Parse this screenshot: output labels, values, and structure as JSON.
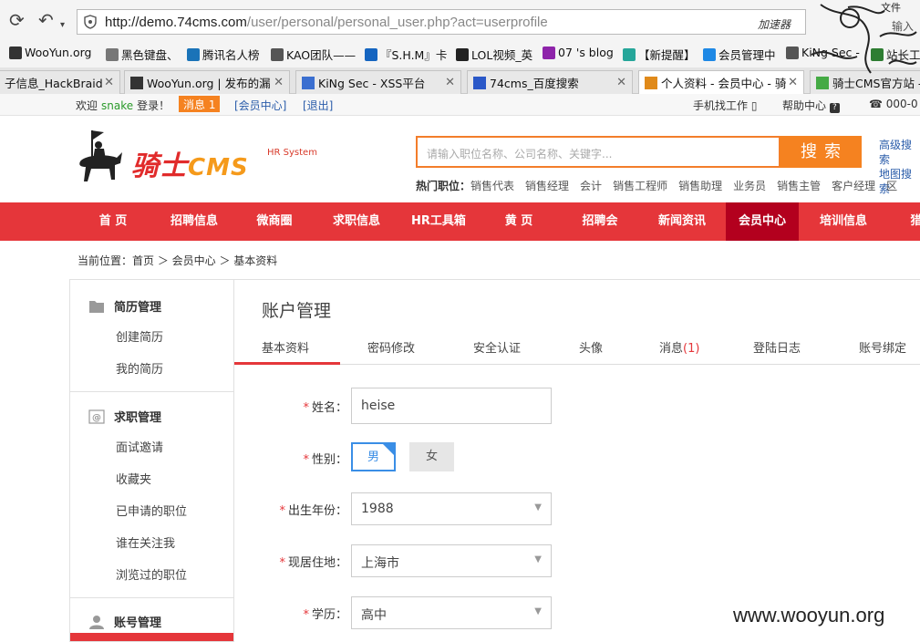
{
  "browser": {
    "url_host": "http://demo.74cms.com",
    "url_path": "/user/personal/personal_user.php?act=userprofile",
    "accelerator": "加速器",
    "menu_file": "文件",
    "menu_input": "输入",
    "bookmarks": [
      {
        "label": "WooYun.org",
        "color": "#333"
      },
      {
        "label": "黑色键盘、",
        "color": "#777"
      },
      {
        "label": "腾讯名人榜",
        "color": "#1a73b8"
      },
      {
        "label": "KAO团队——",
        "color": "#555"
      },
      {
        "label": "『S.H.M』卡",
        "color": "#1565c0"
      },
      {
        "label": "LOL视频_英",
        "color": "#222"
      },
      {
        "label": "07 's blog",
        "color": "#8e24aa"
      },
      {
        "label": "【新提醒】",
        "color": "#26a69a"
      },
      {
        "label": "会员管理中",
        "color": "#1e88e5"
      },
      {
        "label": "KiNg Sec -",
        "color": "#555"
      },
      {
        "label": "站长工",
        "color": "#2e7d32"
      }
    ],
    "tabs": [
      {
        "label": "子信息_HackBraid",
        "active": false
      },
      {
        "label": "WooYun.org | 发布的漏",
        "active": false
      },
      {
        "label": "KiNg Sec - XSS平台",
        "active": false
      },
      {
        "label": "74cms_百度搜索",
        "active": false
      },
      {
        "label": "个人资料 - 会员中心 - 骑",
        "active": true
      },
      {
        "label": "骑士CMS官方站 -",
        "active": false
      }
    ]
  },
  "topbar": {
    "welcome": "欢迎",
    "username": "snake",
    "login_suffix": "登录！",
    "message_badge": "消息 1",
    "member_center": "[会员中心]",
    "logout": "[退出]",
    "mobile": "手机找工作",
    "help": "帮助中心",
    "phone": "000-0"
  },
  "header": {
    "logo_cn": "骑士",
    "logo_cms": "CMS",
    "logo_sub": "HR System",
    "search_placeholder": "请输入职位名称、公司名称、关键字...",
    "search_button": "搜索",
    "adv_search": "高级搜索",
    "map_search": "地图搜索",
    "hot_label": "热门职位：",
    "hot_jobs": [
      "销售代表",
      "销售经理",
      "会计",
      "销售工程师",
      "销售助理",
      "业务员",
      "销售主管",
      "客户经理",
      "区"
    ]
  },
  "mainnav": [
    {
      "label": "首 页",
      "active": false
    },
    {
      "label": "招聘信息",
      "active": false
    },
    {
      "label": "微商圈",
      "active": false
    },
    {
      "label": "求职信息",
      "active": false
    },
    {
      "label": "HR工具箱",
      "active": false
    },
    {
      "label": "黄 页",
      "active": false
    },
    {
      "label": "招聘会",
      "active": false
    },
    {
      "label": "新闻资讯",
      "active": false
    },
    {
      "label": "会员中心",
      "active": true
    },
    {
      "label": "培训信息",
      "active": false
    },
    {
      "label": "猎",
      "active": false
    }
  ],
  "breadcrumb": "当前位置：首页 ＞ 会员中心 ＞ 基本资料",
  "sidebar": {
    "resume": {
      "title": "简历管理",
      "items": [
        "创建简历",
        "我的简历"
      ]
    },
    "job": {
      "title": "求职管理",
      "items": [
        "面试邀请",
        "收藏夹",
        "已申请的职位",
        "谁在关注我",
        "浏览过的职位"
      ]
    },
    "account": {
      "title": "账号管理"
    }
  },
  "content": {
    "title": "账户管理",
    "tabs": [
      {
        "label": "基本资料",
        "active": true
      },
      {
        "label": "密码修改",
        "active": false
      },
      {
        "label": "安全认证",
        "active": false
      },
      {
        "label": "头像",
        "active": false
      },
      {
        "label": "消息",
        "count": "(1)",
        "active": false
      },
      {
        "label": "登陆日志",
        "active": false
      },
      {
        "label": "账号绑定",
        "active": false
      }
    ],
    "form": {
      "name_label": "姓名：",
      "name_value": "heise",
      "gender_label": "性别：",
      "gender_male": "男",
      "gender_female": "女",
      "gender_selected": "男",
      "birth_label": "出生年份：",
      "birth_value": "1988",
      "city_label": "现居住地：",
      "city_value": "上海市",
      "edu_label": "学历：",
      "edu_value": "高中"
    }
  },
  "watermark": "www.wooyun.org",
  "colors": {
    "brand_red": "#e5363a",
    "nav_active": "#b3001e",
    "accent_orange": "#f58220",
    "link_blue": "#2a5caa"
  }
}
